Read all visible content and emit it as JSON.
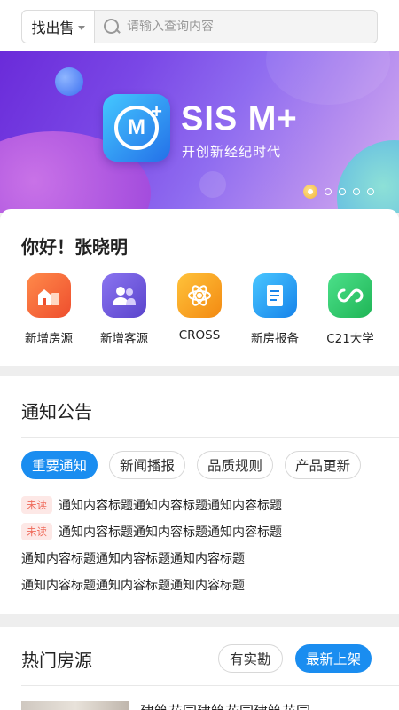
{
  "search": {
    "type_selected": "找出售",
    "placeholder": "请输入查询内容"
  },
  "banner": {
    "brand_text": "SIS M+",
    "logo_letter": "M",
    "logo_plus": "+",
    "slogan": "开创新经纪时代",
    "carousel_total": 5,
    "carousel_active_index": 0
  },
  "greeting": "你好！张晓明",
  "quick_actions": [
    {
      "label": "新增房源",
      "icon": "house-add-icon",
      "color": "#f26a3d"
    },
    {
      "label": "新增客源",
      "icon": "customers-icon",
      "color": "#6a5bdc"
    },
    {
      "label": "CROSS",
      "icon": "cross-network-icon",
      "color": "#f5a21c"
    },
    {
      "label": "新房报备",
      "icon": "report-document-icon",
      "color": "#1fa4f0"
    },
    {
      "label": "C21大学",
      "icon": "infinity-icon",
      "color": "#2cc96a"
    }
  ],
  "notices": {
    "title": "通知公告",
    "tabs": [
      "重要通知",
      "新闻播报",
      "品质规则",
      "产品更新"
    ],
    "active_tab": "重要通知",
    "unread_label": "未读",
    "items": [
      {
        "unread": true,
        "text": "通知内容标题通知内容标题通知内容标题"
      },
      {
        "unread": true,
        "text": "通知内容标题通知内容标题通知内容标题"
      },
      {
        "unread": false,
        "text": "通知内容标题通知内容标题通知内容标题"
      },
      {
        "unread": false,
        "text": "通知内容标题通知内容标题通知内容标题"
      }
    ]
  },
  "hot_listings": {
    "title": "热门房源",
    "filters": [
      "有实勘",
      "最新上架"
    ],
    "active_filter": "最新上架",
    "first_item_title": "建筑花园建筑花园建筑花园"
  },
  "colors": {
    "accent": "#1a8df0",
    "unread_badge_bg": "#fde8e6",
    "unread_badge_text": "#ef6a5a"
  }
}
